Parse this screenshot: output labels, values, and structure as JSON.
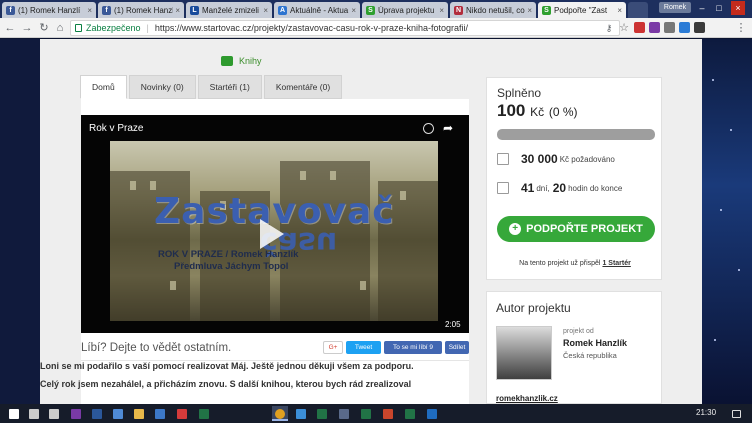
{
  "browser": {
    "tabs": [
      {
        "label": "(1) Romek Hanzlí",
        "icon": "facebook-icon",
        "color": "#3b5998",
        "glyph": "f"
      },
      {
        "label": "(1) Romek Hanzl",
        "icon": "facebook-icon",
        "color": "#3b5998",
        "glyph": "f"
      },
      {
        "label": "Manželé zmizeli",
        "icon": "news-icon",
        "color": "#1a4c9c",
        "glyph": "L"
      },
      {
        "label": "Aktuálně - Aktua",
        "icon": "news-icon",
        "color": "#2d74d0",
        "glyph": "A"
      },
      {
        "label": "Úprava projektu",
        "icon": "startovac-icon",
        "color": "#2fa02f",
        "glyph": "S"
      },
      {
        "label": "Nikdo netušil, co",
        "icon": "news-icon",
        "color": "#b22c3c",
        "glyph": "N"
      },
      {
        "label": "Podpořte \"Zast",
        "icon": "startovac-icon",
        "color": "#2fa02f",
        "glyph": "S",
        "active": true
      }
    ],
    "profile": "Romek",
    "secure_label": "Zabezpečeno",
    "url": "https://www.startovac.cz/projekty/zastavovac-casu-rok-v-praze-kniha-fotografii/"
  },
  "page": {
    "category": "Knihy",
    "tabs": [
      "Domů",
      "Novinky (0)",
      "Startéři (1)",
      "Komentáře (0)"
    ],
    "video": {
      "title": "Rok v Praze",
      "big_title": "Zastavovač",
      "big_title_mirror": "času",
      "subtitle1": "ROK V PRAZE / Romek Hanzlík",
      "subtitle2": "Předmluva Jáchym Topol",
      "duration": "2:05"
    },
    "like_prompt": "Líbí? Dejte to vědět ostatním.",
    "social": {
      "gplus": "G+",
      "tweet": "Tweet",
      "fb_like": "To se mi líbí 9",
      "share": "Sdílet"
    },
    "description": [
      "Loni se mi podařilo  s vaší pomocí realizovat Máj. Ještě jednou děkuji všem za podporu.",
      "Celý rok jsem nezahálel, a přicházím znovu. S další knihou, kterou bych rád zrealizoval"
    ]
  },
  "funding": {
    "heading": "Splněno",
    "amount": "100",
    "currency": "Kč",
    "percent": "(0 %)",
    "progress_fraction": 0.0,
    "goal_value": "30 000",
    "goal_label": "Kč požadováno",
    "days_value": "41",
    "days_label": "dní,",
    "hours_value": "20",
    "hours_label": "hodin do konce",
    "support_button": "PODPOŘTE PROJEKT",
    "contrib_text": "Na tento projekt už přispěl",
    "contrib_link": "1 Startér"
  },
  "author": {
    "heading": "Autor projektu",
    "label": "projekt od",
    "name": "Romek Hanzlík",
    "country": "Česká republika",
    "link": "romekhanzlik.cz"
  },
  "taskbar": {
    "time": "21:30",
    "apps": [
      {
        "icon": "windows-start-icon",
        "color": "#ffffff"
      },
      {
        "icon": "search-icon",
        "color": "#cccccc"
      },
      {
        "icon": "task-view-icon",
        "color": "#cccccc"
      },
      {
        "icon": "onenote-icon",
        "color": "#7a3aa6"
      },
      {
        "icon": "word-icon",
        "color": "#2b579a"
      },
      {
        "icon": "screen-icon",
        "color": "#4f8ad6"
      },
      {
        "icon": "explorer-icon",
        "color": "#e8b84a"
      },
      {
        "icon": "store-icon",
        "color": "#3c78c8"
      },
      {
        "icon": "vivaldi-icon",
        "color": "#d43b3b"
      },
      {
        "icon": "excel-icon",
        "color": "#217346"
      },
      {
        "icon": "chrome-icon",
        "color": "#e0a020",
        "active": true
      },
      {
        "icon": "photos-icon",
        "color": "#3c8fd8"
      },
      {
        "icon": "excel-icon",
        "color": "#217346"
      },
      {
        "icon": "calc-icon",
        "color": "#5a6a8a"
      },
      {
        "icon": "excel-icon",
        "color": "#217346"
      },
      {
        "icon": "powerpoint-icon",
        "color": "#c9462c"
      },
      {
        "icon": "excel-icon",
        "color": "#217346"
      },
      {
        "icon": "outlook-icon",
        "color": "#1f6cc0"
      }
    ]
  }
}
